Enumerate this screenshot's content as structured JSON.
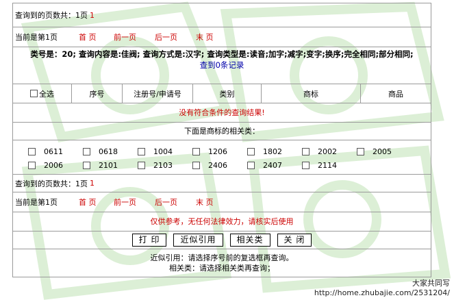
{
  "top_pages": {
    "label": "查询到的页数共：1页",
    "count": "1"
  },
  "top_nav": {
    "current": "当前是第1页",
    "first": "首 页",
    "prev": "前一页",
    "next": "后一页",
    "last": "末 页"
  },
  "condition": {
    "text": "类号是：20; 查询内容是:佳阀; 查询方式是:汉字; 查询类型是:读音;加字;减字;变字;换序;完全相同;部分相同;",
    "result_link": "查到0条记录"
  },
  "table_header": {
    "select_all": "全选",
    "serial": "序号",
    "reg_no": "注册号/申请号",
    "category": "类别",
    "trademark": "商标",
    "goods": "商品"
  },
  "no_result": "没有符合条件的查询结果!",
  "related_title": "下面是商标的相关类：",
  "related_classes": [
    "0611",
    "0618",
    "1004",
    "1206",
    "1802",
    "2002",
    "2005",
    "2006",
    "2101",
    "2103",
    "2406",
    "2407",
    "2114"
  ],
  "bottom_pages": {
    "label": "查询到的页数共：1页",
    "count": "1"
  },
  "bottom_nav": {
    "current": "当前是第1页",
    "first": "首 页",
    "prev": "前一页",
    "next": "后一页",
    "last": "末 页"
  },
  "disclaimer": "仅供参考，无任何法律效力，请核实后使用",
  "buttons": {
    "print": "打 印",
    "similar": "近似引用",
    "related": "相关类",
    "close": "关 闭"
  },
  "notes": {
    "line1": "近似引用：请选择序号前的复选框再查询。",
    "line2": "相关类：请选择相关类再查询；"
  },
  "footer": {
    "line1": "大家共同写",
    "line2": "http://home.zhubajie.com/2531204/"
  },
  "colors": {
    "link_red": "#cc0000",
    "link_blue": "#0000aa",
    "border": "#9a9a9a",
    "watermark": "#d8ecd2"
  }
}
